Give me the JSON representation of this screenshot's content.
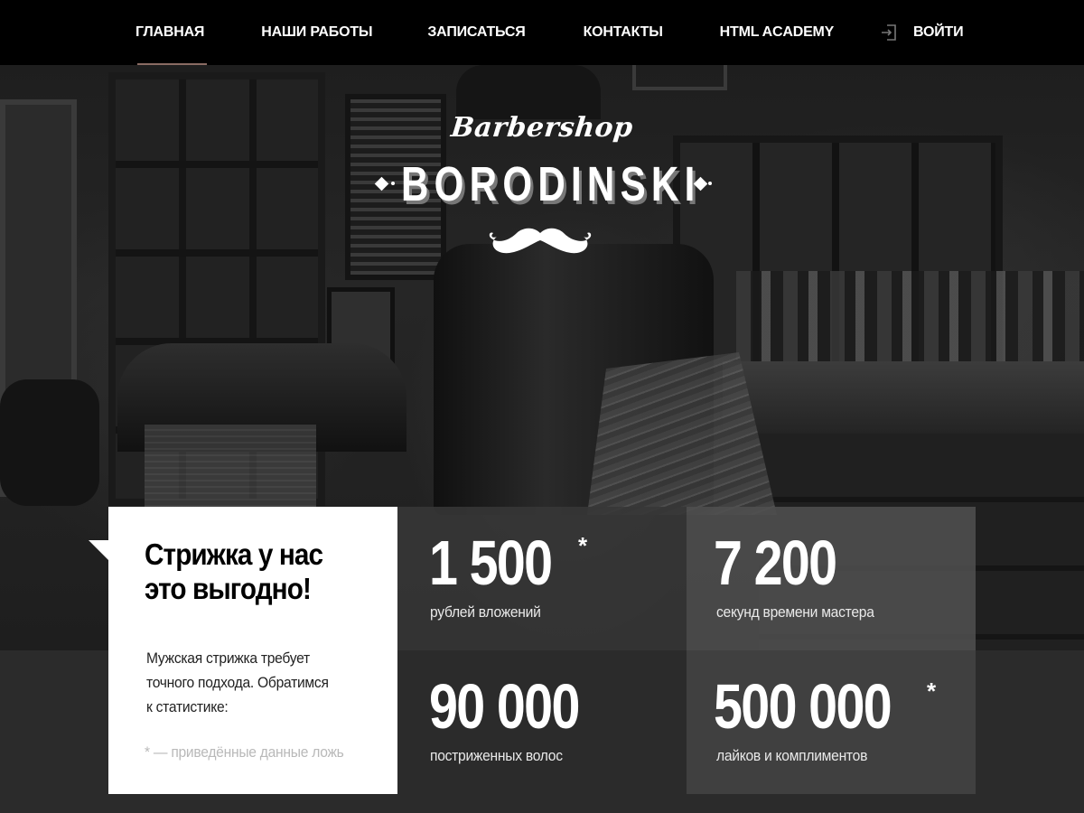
{
  "nav": {
    "items": [
      {
        "label": "Главная",
        "active": true
      },
      {
        "label": "Наши работы",
        "active": false
      },
      {
        "label": "Записаться",
        "active": false
      },
      {
        "label": "Контакты",
        "active": false
      },
      {
        "label": "HTML Academy",
        "active": false
      }
    ],
    "login_label": "Войти",
    "login_icon": "login-icon",
    "active_color": "#8a6b63"
  },
  "logo": {
    "script": "Barbershop",
    "name": "BORODINSKI",
    "icon": "mustache-icon"
  },
  "promo": {
    "title_line1": "Стрижка у нас",
    "title_line2": "это выгодно!",
    "text_line1": "Мужская стрижка требует",
    "text_line2": "точного подхода. Обратимся",
    "text_line3": "к статистике:",
    "note": "* — приведённые данные ложь"
  },
  "stats": [
    {
      "value": "1 500",
      "star": "*",
      "label": "рублей вложений"
    },
    {
      "value": "7 200",
      "star": "",
      "label": "секунд времени мастера"
    },
    {
      "value": "90 000",
      "star": "",
      "label": "постриженных волос"
    },
    {
      "value": "500 000",
      "star": "*",
      "label": "лайков и комплиментов"
    }
  ]
}
